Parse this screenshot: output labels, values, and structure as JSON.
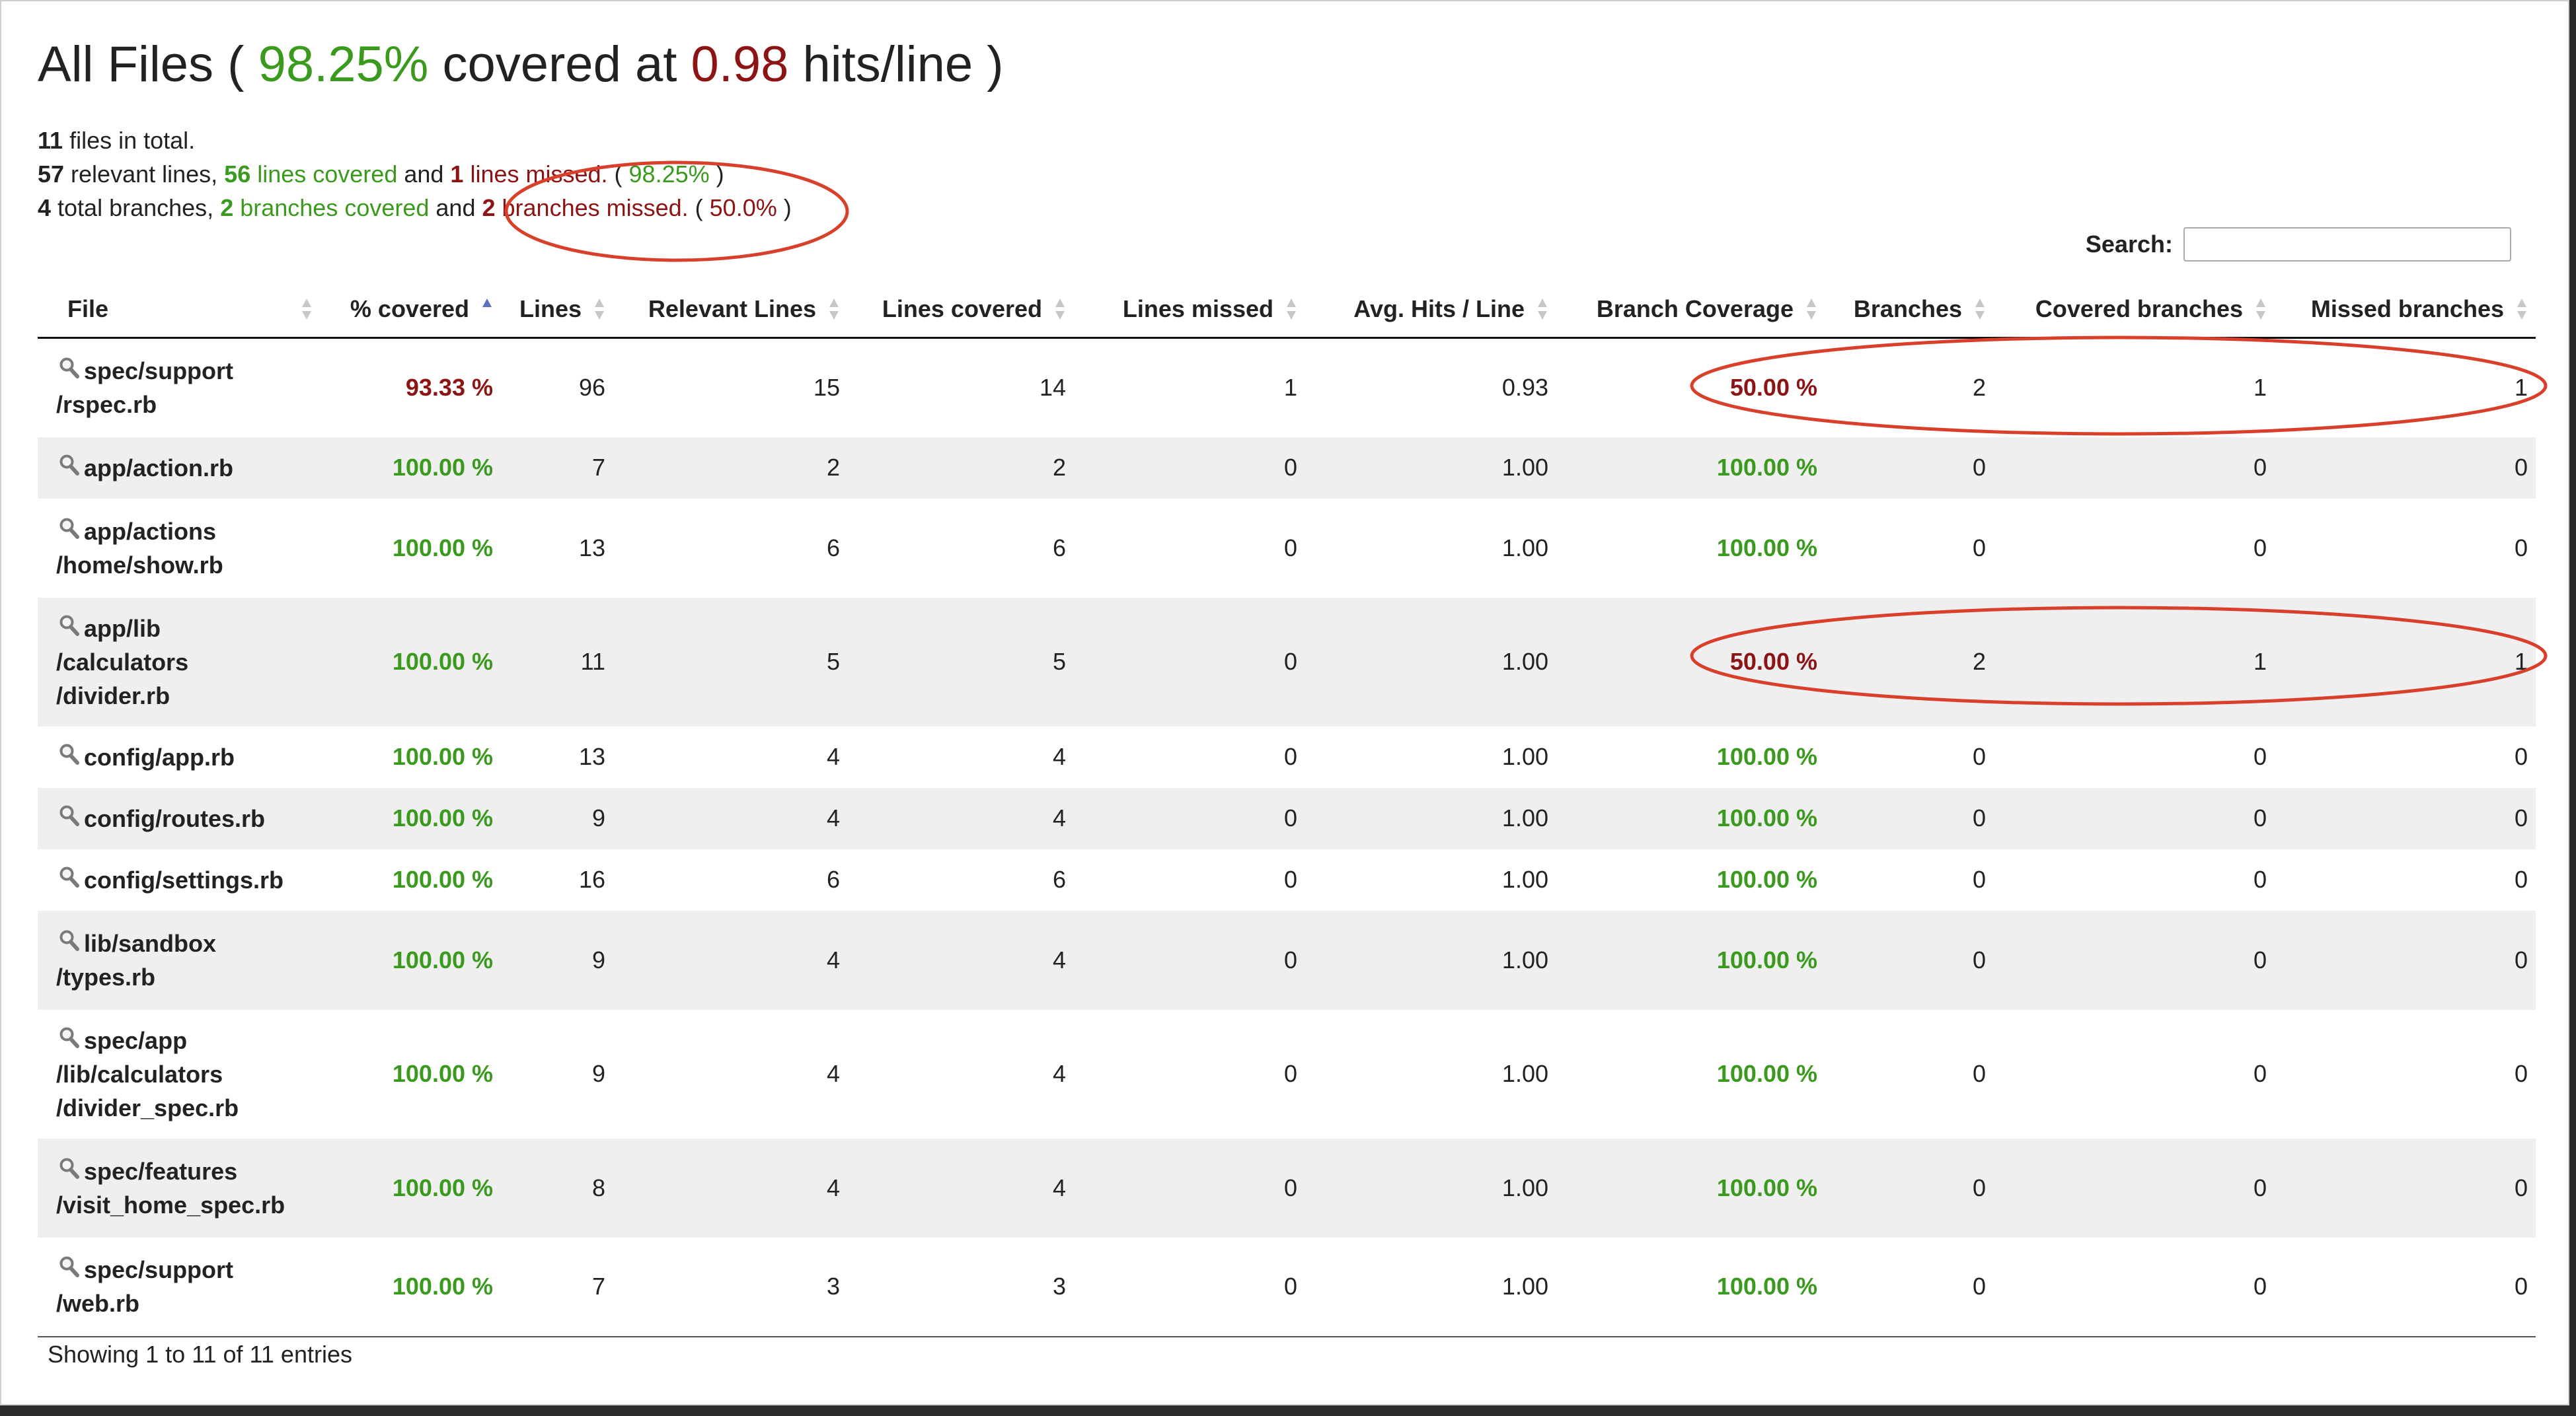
{
  "header": {
    "prefix": "All Files ( ",
    "covered_percent": "98.25%",
    "mid": " covered at ",
    "hits": "0.98",
    "suffix": " hits/line )"
  },
  "summary": {
    "files_count": "11",
    "files_text": " files in total.",
    "relevant_lines": "57",
    "relevant_text": " relevant lines, ",
    "lines_covered": "56",
    "lines_covered_text": " lines covered",
    "and1": " and ",
    "lines_missed": "1",
    "lines_missed_text": " lines missed.",
    "open1": " ( ",
    "lines_pct": "98.25%",
    "close1": " )",
    "total_branches": "4",
    "total_branches_text": " total branches, ",
    "branches_covered": "2",
    "branches_covered_text": " branches covered",
    "and2": " and ",
    "branches_missed": "2",
    "branches_missed_text": " branches missed.",
    "open2": " ( ",
    "branch_pct": "50.0%",
    "close2": " )"
  },
  "search": {
    "label": "Search:",
    "value": ""
  },
  "table": {
    "columns": [
      "File",
      "% covered",
      "Lines",
      "Relevant Lines",
      "Lines covered",
      "Lines missed",
      "Avg. Hits / Line",
      "Branch Coverage",
      "Branches",
      "Covered branches",
      "Missed branches"
    ],
    "sorted_column": "% covered",
    "rows": [
      {
        "file": "spec/support\n/rspec.rb",
        "covered": "93.33 %",
        "lines": "96",
        "relevant": "15",
        "lines_covered": "14",
        "lines_missed": "1",
        "avg_hits": "0.93",
        "branch_coverage": "50.00 %",
        "branches": "2",
        "covered_branches": "1",
        "missed_branches": "1"
      },
      {
        "file": "app/action.rb",
        "covered": "100.00 %",
        "lines": "7",
        "relevant": "2",
        "lines_covered": "2",
        "lines_missed": "0",
        "avg_hits": "1.00",
        "branch_coverage": "100.00 %",
        "branches": "0",
        "covered_branches": "0",
        "missed_branches": "0"
      },
      {
        "file": "app/actions\n/home/show.rb",
        "covered": "100.00 %",
        "lines": "13",
        "relevant": "6",
        "lines_covered": "6",
        "lines_missed": "0",
        "avg_hits": "1.00",
        "branch_coverage": "100.00 %",
        "branches": "0",
        "covered_branches": "0",
        "missed_branches": "0"
      },
      {
        "file": "app/lib\n/calculators\n/divider.rb",
        "covered": "100.00 %",
        "lines": "11",
        "relevant": "5",
        "lines_covered": "5",
        "lines_missed": "0",
        "avg_hits": "1.00",
        "branch_coverage": "50.00 %",
        "branches": "2",
        "covered_branches": "1",
        "missed_branches": "1"
      },
      {
        "file": "config/app.rb",
        "covered": "100.00 %",
        "lines": "13",
        "relevant": "4",
        "lines_covered": "4",
        "lines_missed": "0",
        "avg_hits": "1.00",
        "branch_coverage": "100.00 %",
        "branches": "0",
        "covered_branches": "0",
        "missed_branches": "0"
      },
      {
        "file": "config/routes.rb",
        "covered": "100.00 %",
        "lines": "9",
        "relevant": "4",
        "lines_covered": "4",
        "lines_missed": "0",
        "avg_hits": "1.00",
        "branch_coverage": "100.00 %",
        "branches": "0",
        "covered_branches": "0",
        "missed_branches": "0"
      },
      {
        "file": "config/settings.rb",
        "covered": "100.00 %",
        "lines": "16",
        "relevant": "6",
        "lines_covered": "6",
        "lines_missed": "0",
        "avg_hits": "1.00",
        "branch_coverage": "100.00 %",
        "branches": "0",
        "covered_branches": "0",
        "missed_branches": "0"
      },
      {
        "file": "lib/sandbox\n/types.rb",
        "covered": "100.00 %",
        "lines": "9",
        "relevant": "4",
        "lines_covered": "4",
        "lines_missed": "0",
        "avg_hits": "1.00",
        "branch_coverage": "100.00 %",
        "branches": "0",
        "covered_branches": "0",
        "missed_branches": "0"
      },
      {
        "file": "spec/app\n/lib/calculators\n/divider_spec.rb",
        "covered": "100.00 %",
        "lines": "9",
        "relevant": "4",
        "lines_covered": "4",
        "lines_missed": "0",
        "avg_hits": "1.00",
        "branch_coverage": "100.00 %",
        "branches": "0",
        "covered_branches": "0",
        "missed_branches": "0"
      },
      {
        "file": "spec/features\n/visit_home_spec.rb",
        "covered": "100.00 %",
        "lines": "8",
        "relevant": "4",
        "lines_covered": "4",
        "lines_missed": "0",
        "avg_hits": "1.00",
        "branch_coverage": "100.00 %",
        "branches": "0",
        "covered_branches": "0",
        "missed_branches": "0"
      },
      {
        "file": "spec/support\n/web.rb",
        "covered": "100.00 %",
        "lines": "7",
        "relevant": "3",
        "lines_covered": "3",
        "lines_missed": "0",
        "avg_hits": "1.00",
        "branch_coverage": "100.00 %",
        "branches": "0",
        "covered_branches": "0",
        "missed_branches": "0"
      }
    ]
  },
  "footer": {
    "info": "Showing 1 to 11 of 11 entries"
  },
  "colors": {
    "covered": "#3a9a1e",
    "missed": "#8c1414",
    "annotation": "#d9402c",
    "zebra": "#efefef"
  },
  "icons": {
    "file_link": "magnifier-icon",
    "sort": "sort-arrows-icon"
  }
}
